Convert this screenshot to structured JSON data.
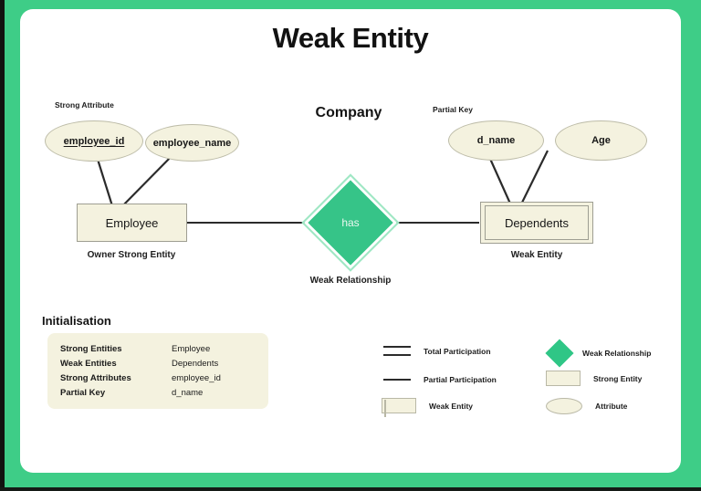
{
  "page": {
    "title": "Weak Entity",
    "subtitle": "Company",
    "border_color": "#3ECD87",
    "canvas_color": "#ffffff"
  },
  "colors": {
    "accent_green": "#3ECD87",
    "diamond_green": "#36C488",
    "shape_fill": "#F4F2DF",
    "shape_stroke": "#9e9e92",
    "line": "#2b2b2b",
    "text": "#141414"
  },
  "diagram": {
    "annotations": {
      "strong_attribute": "Strong Attribute",
      "partial_key": "Partial Key",
      "owner_strong_entity": "Owner Strong Entity",
      "weak_entity": "Weak Entity",
      "weak_relationship": "Weak Relationship"
    },
    "attributes": [
      {
        "id": "employee_id",
        "label": "employee_id",
        "is_key": true
      },
      {
        "id": "employee_name",
        "label": "employee_name",
        "is_key": false
      },
      {
        "id": "d_name",
        "label": "d_name",
        "is_key": false
      },
      {
        "id": "age",
        "label": "Age",
        "is_key": false
      }
    ],
    "entities": [
      {
        "id": "employee",
        "label": "Employee",
        "kind": "strong"
      },
      {
        "id": "dependents",
        "label": "Dependents",
        "kind": "weak"
      }
    ],
    "relationship": {
      "id": "has",
      "label": "has",
      "kind": "weak"
    }
  },
  "initialisation": {
    "title": "Initialisation",
    "rows": [
      {
        "key": "Strong Entities",
        "value": "Employee"
      },
      {
        "key": "Weak Entities",
        "value": "Dependents"
      },
      {
        "key": "Strong Attributes",
        "value": "employee_id"
      },
      {
        "key": "Partial Key",
        "value": "d_name"
      }
    ]
  },
  "legend": {
    "left": [
      {
        "id": "total-participation",
        "label": "Total Participation",
        "swatch": "double-line-icon"
      },
      {
        "id": "partial-participation",
        "label": "Partial Participation",
        "swatch": "single-line-icon"
      },
      {
        "id": "weak-entity",
        "label": "Weak Entity",
        "swatch": "double-rect-icon"
      }
    ],
    "right": [
      {
        "id": "weak-relationship",
        "label": "Weak Relationship",
        "swatch": "diamond-icon"
      },
      {
        "id": "strong-entity",
        "label": "Strong Entity",
        "swatch": "rect-icon"
      },
      {
        "id": "attribute",
        "label": "Attribute",
        "swatch": "ellipse-icon"
      }
    ]
  }
}
